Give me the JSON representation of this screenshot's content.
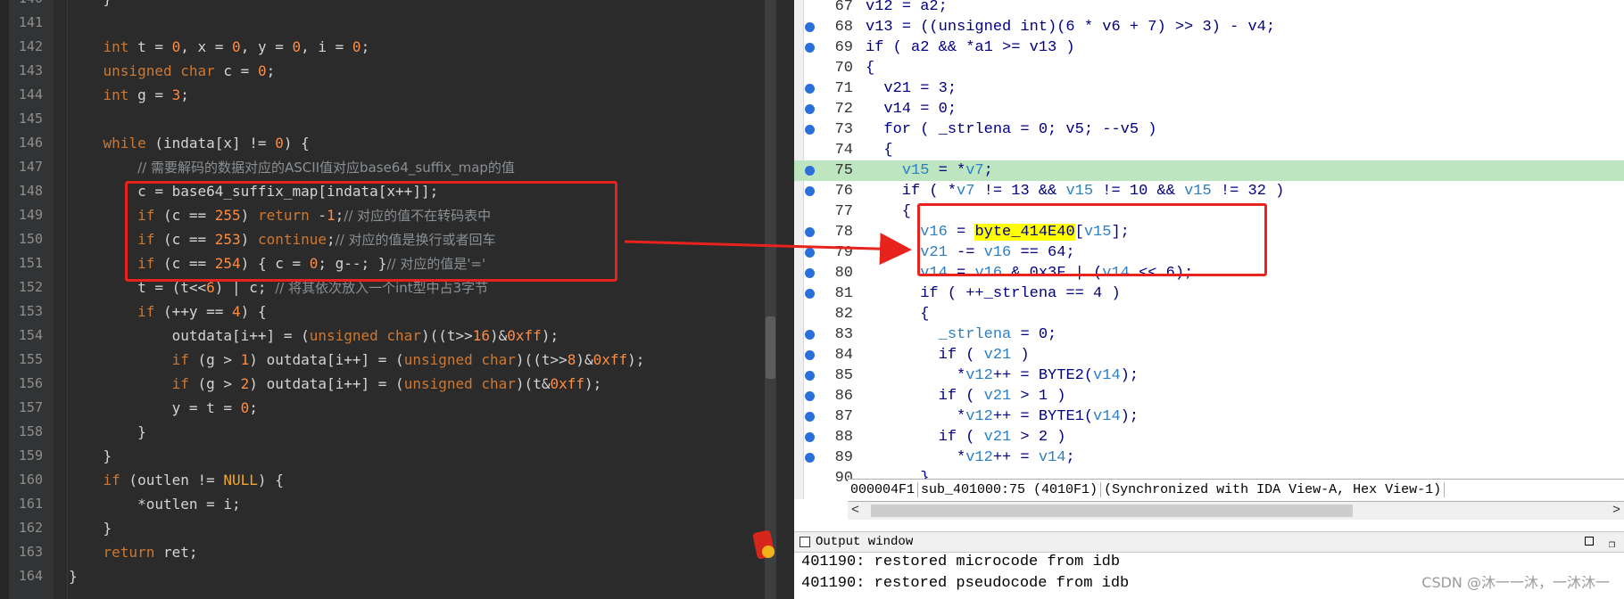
{
  "left_editor": {
    "lines": [
      {
        "n": "140",
        "html": "    }"
      },
      {
        "n": "141",
        "html": ""
      },
      {
        "n": "142",
        "html": "    <span class=\"t-type\">int</span> t = <span class=\"t-num\">0</span>, x = <span class=\"t-num\">0</span>, y = <span class=\"t-num\">0</span>, i = <span class=\"t-num\">0</span>;"
      },
      {
        "n": "143",
        "html": "    <span class=\"t-type\">unsigned char</span> c = <span class=\"t-num\">0</span>;"
      },
      {
        "n": "144",
        "html": "    <span class=\"t-type\">int</span> g = <span class=\"t-num\">3</span>;"
      },
      {
        "n": "145",
        "html": ""
      },
      {
        "n": "146",
        "html": "    <span class=\"t-kw\">while</span> (indata[x] != <span class=\"t-num\">0</span>) {"
      },
      {
        "n": "147",
        "html": "        <span class=\"t-cm\">// 需要解码的数据对应的ASCII值对应base64_suffix_map的值</span>"
      },
      {
        "n": "148",
        "html": "        c = base64_suffix_map[indata[x++]];"
      },
      {
        "n": "149",
        "html": "        <span class=\"t-kw\">if</span> (c == <span class=\"t-num\">255</span>) <span class=\"t-kw\">return</span> -<span class=\"t-num\">1</span>;<span class=\"t-cm\">// 对应的值不在转码表中</span>"
      },
      {
        "n": "150",
        "html": "        <span class=\"t-kw\">if</span> (c == <span class=\"t-num\">253</span>) <span class=\"t-kw\">continue</span>;<span class=\"t-cm\">// 对应的值是换行或者回车</span>"
      },
      {
        "n": "151",
        "html": "        <span class=\"t-kw\">if</span> (c == <span class=\"t-num\">254</span>) { c = <span class=\"t-num\">0</span>; g--; }<span class=\"t-cm\">// 对应的值是'='</span>"
      },
      {
        "n": "152",
        "html": "        t = (t&lt;&lt;<span class=\"t-num\">6</span>) | c; <span class=\"t-cm\">// 将其依次放入一个int型中占3字节</span>"
      },
      {
        "n": "153",
        "html": "        <span class=\"t-kw\">if</span> (++y == <span class=\"t-num\">4</span>) {"
      },
      {
        "n": "154",
        "html": "            outdata[i++] = (<span class=\"t-type\">unsigned char</span>)((t&gt;&gt;<span class=\"t-num\">16</span>)&amp;<span class=\"t-num\">0xff</span>);"
      },
      {
        "n": "155",
        "html": "            <span class=\"t-kw\">if</span> (g &gt; <span class=\"t-num\">1</span>) outdata[i++] = (<span class=\"t-type\">unsigned char</span>)((t&gt;&gt;<span class=\"t-num\">8</span>)&amp;<span class=\"t-num\">0xff</span>);"
      },
      {
        "n": "156",
        "html": "            <span class=\"t-kw\">if</span> (g &gt; <span class=\"t-num\">2</span>) outdata[i++] = (<span class=\"t-type\">unsigned char</span>)(t&amp;<span class=\"t-num\">0xff</span>);"
      },
      {
        "n": "157",
        "html": "            y = t = <span class=\"t-num\">0</span>;"
      },
      {
        "n": "158",
        "html": "        }"
      },
      {
        "n": "159",
        "html": "    }"
      },
      {
        "n": "160",
        "html": "    <span class=\"t-kw\">if</span> (outlen != <span class=\"t-null\">NULL</span>) {"
      },
      {
        "n": "161",
        "html": "        *outlen = i;"
      },
      {
        "n": "162",
        "html": "    }"
      },
      {
        "n": "163",
        "html": "    <span class=\"t-kw\">return</span> ret;"
      },
      {
        "n": "164",
        "html": "}"
      }
    ]
  },
  "ida_view": {
    "lines": [
      {
        "n": "67",
        "bp": false,
        "hl": false,
        "html": "v12 = a2;"
      },
      {
        "n": "68",
        "bp": true,
        "hl": false,
        "html": "v13 = ((unsigned int)(6 * v6 + 7) &gt;&gt; 3) - v4;"
      },
      {
        "n": "69",
        "bp": true,
        "hl": false,
        "html": "if ( a2 &amp;&amp; *a1 &gt;= v13 )"
      },
      {
        "n": "70",
        "bp": false,
        "hl": false,
        "html": "{"
      },
      {
        "n": "71",
        "bp": true,
        "hl": false,
        "html": "  v21 = 3;"
      },
      {
        "n": "72",
        "bp": true,
        "hl": false,
        "html": "  v14 = 0;"
      },
      {
        "n": "73",
        "bp": true,
        "hl": false,
        "html": "  for ( _strlena = 0; v5; --v5 )"
      },
      {
        "n": "74",
        "bp": false,
        "hl": false,
        "html": "  {"
      },
      {
        "n": "75",
        "bp": true,
        "hl": true,
        "html": "    <span class=\"i-var\">v15</span> = *<span class=\"i-var\">v7</span>;"
      },
      {
        "n": "76",
        "bp": true,
        "hl": false,
        "html": "    if ( *<span class=\"i-var\">v7</span> != 13 &amp;&amp; <span class=\"i-var\">v15</span> != 10 &amp;&amp; <span class=\"i-var\">v15</span> != 32 )"
      },
      {
        "n": "77",
        "bp": false,
        "hl": false,
        "html": "    {"
      },
      {
        "n": "78",
        "bp": true,
        "hl": false,
        "html": "      <span class=\"i-var\">v16</span> = <span class=\"i-hl\">byte_414E40</span>[<span class=\"i-var\">v15</span>];"
      },
      {
        "n": "79",
        "bp": true,
        "hl": false,
        "html": "      <span class=\"i-var\">v21</span> -= <span class=\"i-var\">v16</span> == 64;"
      },
      {
        "n": "80",
        "bp": true,
        "hl": false,
        "html": "      <span class=\"i-var\">v14</span> = <span class=\"i-var\">v16</span> &amp; 0x3F | (<span class=\"i-var\">v14</span> &lt;&lt; 6);"
      },
      {
        "n": "81",
        "bp": true,
        "hl": false,
        "html": "      if ( ++_strlena == 4 )"
      },
      {
        "n": "82",
        "bp": false,
        "hl": false,
        "html": "      {"
      },
      {
        "n": "83",
        "bp": true,
        "hl": false,
        "html": "        <span class=\"i-var\">_strlena</span> = 0;"
      },
      {
        "n": "84",
        "bp": true,
        "hl": false,
        "html": "        if ( <span class=\"i-var\">v21</span> )"
      },
      {
        "n": "85",
        "bp": true,
        "hl": false,
        "html": "          *<span class=\"i-var\">v12</span>++ = BYTE2(<span class=\"i-var\">v14</span>);"
      },
      {
        "n": "86",
        "bp": true,
        "hl": false,
        "html": "        if ( <span class=\"i-var\">v21</span> &gt; 1 )"
      },
      {
        "n": "87",
        "bp": true,
        "hl": false,
        "html": "          *<span class=\"i-var\">v12</span>++ = BYTE1(<span class=\"i-var\">v14</span>);"
      },
      {
        "n": "88",
        "bp": true,
        "hl": false,
        "html": "        if ( <span class=\"i-var\">v21</span> &gt; 2 )"
      },
      {
        "n": "89",
        "bp": true,
        "hl": false,
        "html": "          *<span class=\"i-var\">v12</span>++ = <span class=\"i-var\">v14</span>;"
      },
      {
        "n": "90",
        "bp": false,
        "hl": false,
        "html": "      }"
      }
    ],
    "status_addr": "000004F1",
    "status_func": "sub_401000:75 (4010F1)",
    "status_sync": "(Synchronized with IDA View-A, Hex View-1)"
  },
  "output_window": {
    "title": "Output window",
    "lines": [
      "401190: restored microcode from idb",
      "401190: restored pseudocode from idb"
    ]
  },
  "watermark": "CSDN @沐一一沐，一沐沐一",
  "colors": {
    "annotation": "#e8221d",
    "hl_line": "#bde5c0",
    "yellow_hl": "#ffff00"
  }
}
